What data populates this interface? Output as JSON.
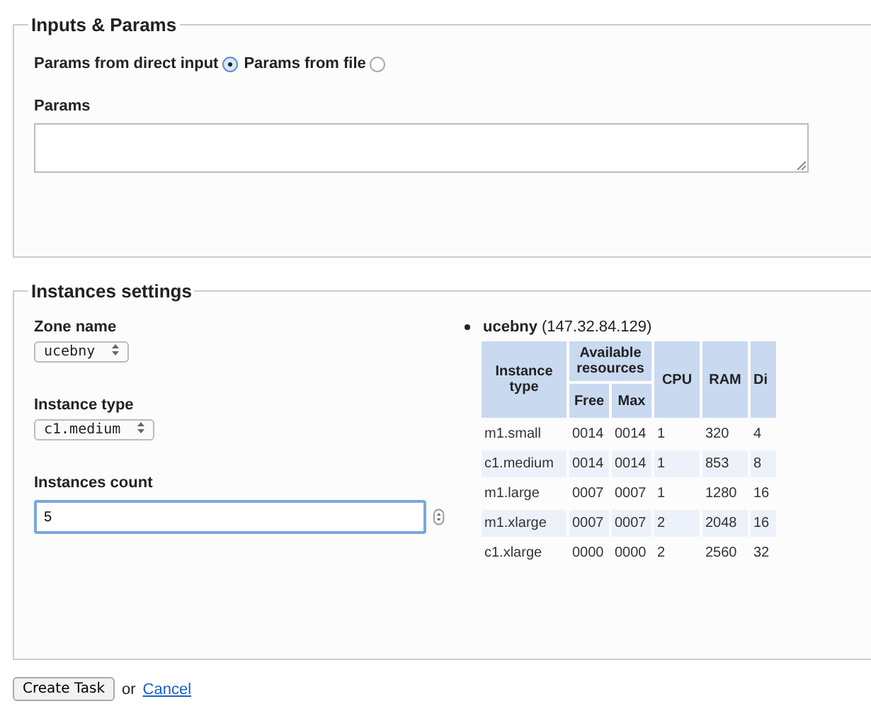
{
  "inputs": {
    "legend": "Inputs & Params",
    "radios": [
      {
        "label": "Params from direct input",
        "selected": true
      },
      {
        "label": "Params from file",
        "selected": false
      }
    ],
    "params_label": "Params"
  },
  "instances": {
    "legend": "Instances settings",
    "zone_label": "Zone name",
    "zone_value": "ucebny",
    "type_label": "Instance type",
    "type_value": "c1.medium",
    "count_label": "Instances count",
    "count_value": "5",
    "zone": {
      "name": "ucebny",
      "address": "(147.32.84.129)"
    },
    "table": {
      "col_type": "Instance type",
      "col_group": "Available resources",
      "col_free": "Free",
      "col_max": "Max",
      "col_cpu": "CPU",
      "col_ram": "RAM",
      "col_5": "Di",
      "rows": [
        [
          "m1.small",
          "0014",
          "0014",
          "1",
          "320",
          "4"
        ],
        [
          "c1.medium",
          "0014",
          "0014",
          "1",
          "853",
          "8"
        ],
        [
          "m1.large",
          "0007",
          "0007",
          "1",
          "1280",
          "16"
        ],
        [
          "m1.xlarge",
          "0007",
          "0007",
          "2",
          "2048",
          "16"
        ],
        [
          "c1.xlarge",
          "0000",
          "0000",
          "2",
          "2560",
          "32"
        ]
      ]
    }
  },
  "actions": {
    "submit": "Create Task",
    "or": "or",
    "cancel": "Cancel"
  }
}
